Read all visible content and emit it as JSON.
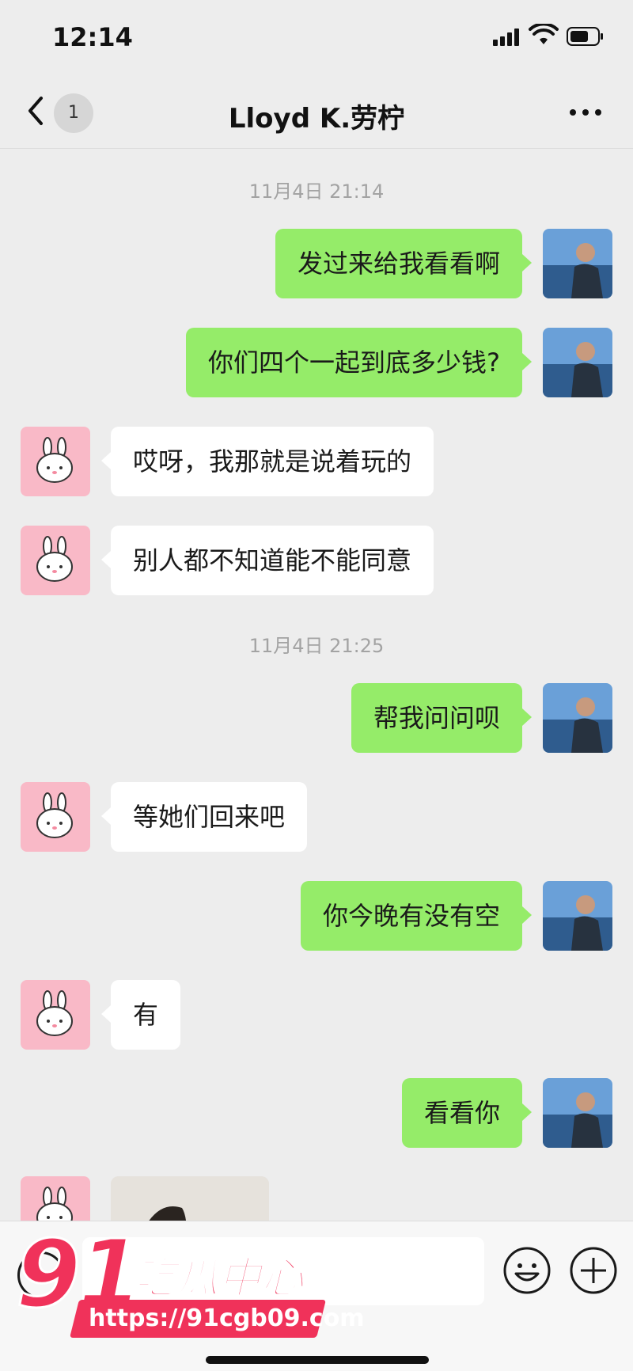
{
  "status_bar": {
    "time": "12:14"
  },
  "nav": {
    "unread_count": "1",
    "title": "Lloyd K.劳柠"
  },
  "chat": {
    "timestamps": [
      "11月4日 21:14",
      "11月4日 21:25"
    ],
    "messages": [
      {
        "side": "out",
        "text": "发过来给我看看啊"
      },
      {
        "side": "out",
        "text": "你们四个一起到底多少钱?"
      },
      {
        "side": "in",
        "text": "哎呀，我那就是说着玩的"
      },
      {
        "side": "in",
        "text": "别人都不知道能不能同意"
      },
      {
        "side": "out",
        "text": "帮我问问呗"
      },
      {
        "side": "in",
        "text": "等她们回来吧"
      },
      {
        "side": "out",
        "text": "你今晚有没有空"
      },
      {
        "side": "in",
        "text": "有"
      },
      {
        "side": "out",
        "text": "看看你"
      },
      {
        "side": "in",
        "type": "image"
      }
    ]
  },
  "watermark": {
    "number": "91",
    "name": "吃瓜中心",
    "url": "https://91cgb09.com"
  },
  "colors": {
    "outgoing_bubble": "#95ec69",
    "incoming_bubble": "#ffffff",
    "background": "#ededed",
    "watermark": "#f0325a"
  },
  "icons": [
    "back-chevron-icon",
    "more-dots-icon",
    "voice-icon",
    "emoji-icon",
    "plus-icon",
    "signal-icon",
    "wifi-icon",
    "battery-icon"
  ]
}
